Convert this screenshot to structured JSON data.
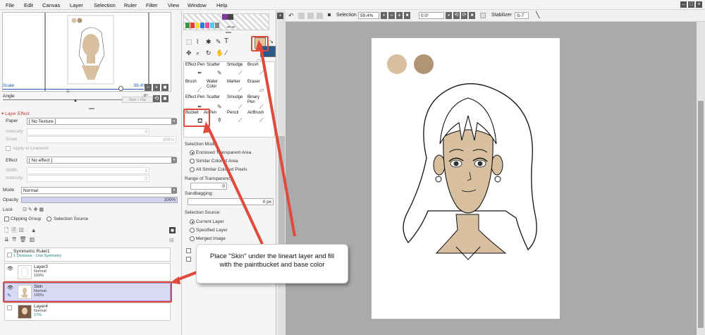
{
  "menu": [
    "File",
    "Edit",
    "Canvas",
    "Layer",
    "Selection",
    "Ruler",
    "Filter",
    "View",
    "Window",
    "Help"
  ],
  "left": {
    "scale_label": "Scale",
    "scale_value": "59.4%",
    "angle_label": "Angle",
    "angle_value": "0°",
    "start_btn": "Start + Flip",
    "layer_effect_title": "Layer Effect",
    "paper_label": "Paper",
    "paper_value": "[ No Texture ]",
    "intensity_label": "Intensity",
    "intensity_value": "0",
    "scale2_label": "Scale",
    "scale2_value": "100%",
    "apply_linework": "Apply to Linework",
    "effect_label": "Effect",
    "effect_value": "[ No effect ]",
    "width_label": "Width",
    "width_value": "1",
    "intensity2_label": "Intensity",
    "intensity2_value": "0",
    "mode_label": "Mode",
    "mode_value": "Normal",
    "opacity_label": "Opacity",
    "opacity_value": "100%",
    "lock_label": "Lock",
    "clipping_group": "Clipping Group",
    "selection_source": "Selection Source"
  },
  "layers": [
    {
      "name": "Symmetric Ruler1",
      "mode": "1 Divisions - Line Symmetry",
      "opacity": ""
    },
    {
      "name": "Layer3",
      "mode": "Normal",
      "opacity": "100%"
    },
    {
      "name": "Skin",
      "mode": "Normal",
      "opacity": "100%"
    },
    {
      "name": "Layer4",
      "mode": "Normal",
      "opacity": "17%"
    }
  ],
  "tools": [
    [
      "Effect Pen",
      "Scatter",
      "Smudge",
      "Brush"
    ],
    [
      "Brush",
      "Water Color",
      "Marker",
      "Eraser"
    ],
    [
      "Effect Pen",
      "Scatter",
      "Smudge",
      "Binary Pen"
    ],
    [
      "Bucket",
      "AirPen",
      "Pencil",
      "AirBrush"
    ]
  ],
  "toolopts": {
    "selection_mode": "Selection Mode:",
    "opt1": "Enclosed Transparent Area",
    "opt2": "Similar Colored Area",
    "opt3": "All Similar Colored Pixels",
    "range_label": "Range of Transparency:",
    "range_value": "0",
    "sandbagging": "Sandbagging:",
    "sand_value": "0 px",
    "sel_source": "Selection Source:",
    "src1": "Current Layer",
    "src2": "Specified Layer",
    "src3": "Merged Image"
  },
  "toolbar": {
    "selection_label": "Selection",
    "zoom": "59.4%",
    "angle": "0.0°",
    "stabilizer_label": "Stabilizer",
    "stabilizer_value": "S-7"
  },
  "callout": {
    "line1": "Place \"Skin\" under the lineart layer and fill",
    "line2": "with the paintbucket and base color"
  },
  "colors": {
    "skin": "#d8bf9f",
    "swatch2": "#b19476",
    "highlight": "#e04a3c",
    "selected_layer": "#d9d9f5",
    "main_color": "#e3c29a"
  }
}
